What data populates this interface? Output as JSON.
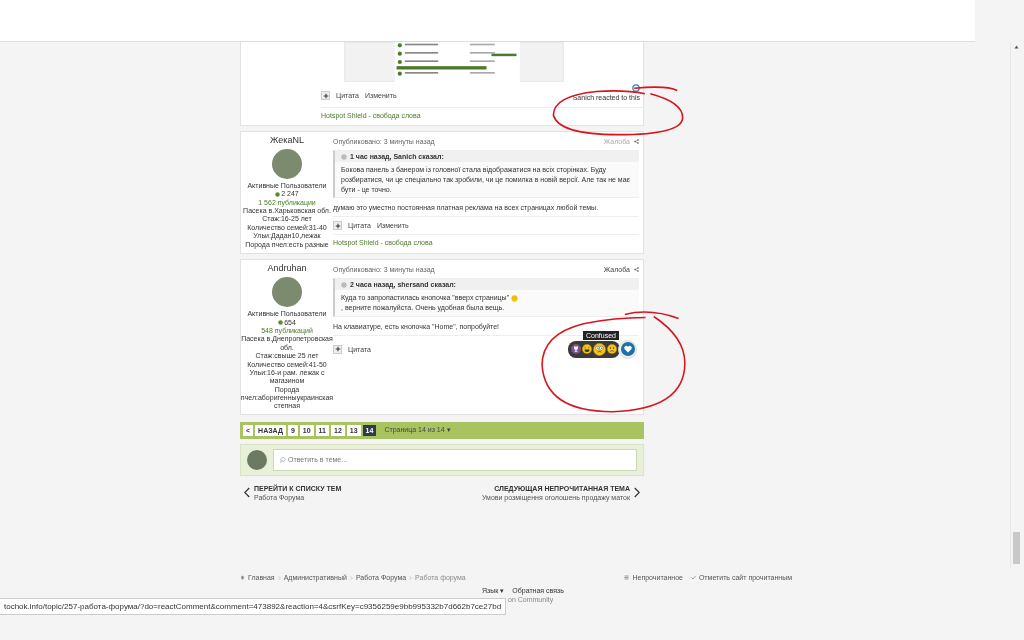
{
  "previous_post": {
    "actions": [
      "Цитата",
      "Изменить"
    ],
    "reaction": {
      "text": "Sanich reacted to this"
    },
    "signature": "Hotspot Shield - свобода слова"
  },
  "posts": [
    {
      "author": "ЖекаNL",
      "group": "Активные Пользователи",
      "reputation": "2 247",
      "post_count": "1 562 публикации",
      "profile_fields": [
        "Пасека в.Харьковская обл.",
        "Стаж:16-25 лет",
        "Количество семей:31-40",
        "Ульи:Дадан10,лежак",
        "Порода пчел:есть разные"
      ],
      "posted": "Опубликовано: 3 минуты назад",
      "report": {
        "label": "Жалоба",
        "faded": true
      },
      "quote": {
        "header": "1 час назад, Sanich сказал:",
        "parts": [
          {
            "kind": "text",
            "text": "Бокова панель з банером із головної стала відображатися на всіх сторінках. Буду розбиратися, чи це спеціально так зробили, чи це помилка в новій версії. Але так не має бути - це точно."
          }
        ]
      },
      "text": "думаю это уместно постоянная платная реклама на всех страницах любой темы.",
      "actions": [
        "Цитата",
        "Изменить"
      ],
      "signature": "Hotspot Shield - свобода слова"
    },
    {
      "author": "Andruhan",
      "group": "Активные Пользователи",
      "reputation": "654",
      "post_count": "548 публикаций",
      "profile_fields": [
        "Пасека в.Днепропетровская обл.",
        "Стаж:свыше 25 лет",
        "Количество семей:41-50",
        "Ульи:16-и рам. лежак с магазином",
        "Порода пчел:аборигенныукраинская степная"
      ],
      "posted": "Опубликовано: 3 минуты назад",
      "report": {
        "label": "Жалоба",
        "faded": false
      },
      "quote": {
        "header": "2 часа назад, shersand сказал:",
        "parts": [
          {
            "kind": "text",
            "text": "Куда то запропастилась кнопочка \"вверх страницы\""
          },
          {
            "kind": "emoji"
          },
          {
            "kind": "text",
            "text": ", верните пожалуйста. Очень удобная была вещь."
          }
        ]
      },
      "text": "На клавиатуре, есть кнопочка \"Home\", попробуйте!",
      "actions": [
        "Цитата"
      ],
      "reaction_picker": {
        "tooltip": "Confused",
        "reactions": [
          {
            "kind": "trophy",
            "selected": false
          },
          {
            "kind": "laugh",
            "selected": false
          },
          {
            "kind": "confused",
            "selected": true
          },
          {
            "kind": "sad",
            "selected": false
          }
        ]
      }
    }
  ],
  "pagination": {
    "prev": "<",
    "back": "НАЗАД",
    "pages": [
      {
        "label": "9",
        "selected": false
      },
      {
        "label": "10",
        "selected": false
      },
      {
        "label": "11",
        "selected": false
      },
      {
        "label": "12",
        "selected": false
      },
      {
        "label": "13",
        "selected": false
      },
      {
        "label": "14",
        "selected": true
      }
    ],
    "page_info": "Страница 14 из 14 ▾"
  },
  "reply": {
    "placeholder": "Ответить в теме..."
  },
  "topic_nav": {
    "back": {
      "caption": "ПЕРЕЙТИ К СПИСКУ ТЕМ",
      "title": "Работа Форума"
    },
    "next": {
      "caption": "СЛЕДУЮЩАЯ НЕПРОЧИТАННАЯ ТЕМА",
      "title": "Умови розміщення оголошень продажу маток"
    }
  },
  "footer": {
    "breadcrumb": [
      {
        "label": "Главная",
        "current": false
      },
      {
        "label": "Административный",
        "current": false
      },
      {
        "label": "Работа Форума",
        "current": false
      },
      {
        "label": "Работа форума",
        "current": true
      }
    ],
    "links": [
      {
        "kind": "unread",
        "label": "Непрочитанное"
      },
      {
        "kind": "mark_read",
        "label": "Отметить сайт прочитанным"
      }
    ],
    "bottom_links": [
      "Язык ▾",
      "Обратная связь"
    ],
    "powered": "on Community"
  },
  "status_url": "tochok.info/topic/257-работа-форума/?do=reactComment&comment=473892&reaction=4&csrfKey=c9356259e9bb995332b7d662b7ce27bd"
}
